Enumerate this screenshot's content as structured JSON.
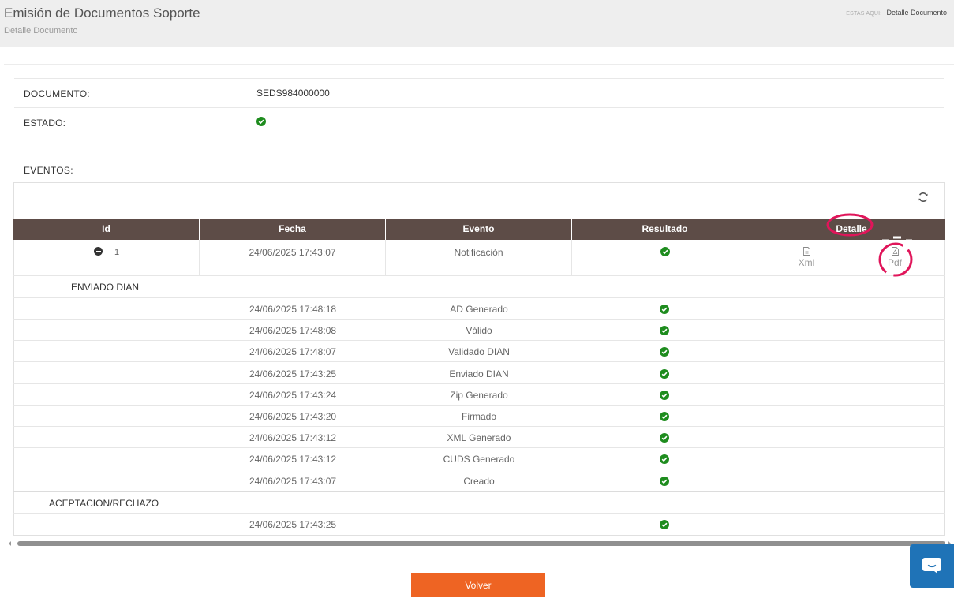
{
  "header": {
    "title": "Emisión de Documentos Soporte",
    "subtitle": "Detalle Documento",
    "breadcrumb_label": "ESTAS AQUI:",
    "breadcrumb_current": "Detalle Documento"
  },
  "document": {
    "label": "DOCUMENTO:",
    "value": "SEDS984000000",
    "estado_label": "ESTADO:",
    "estado_icon": "check-circle-icon"
  },
  "eventos": {
    "label": "EVENTOS:",
    "columns": [
      "Id",
      "Fecha",
      "Evento",
      "Resultado",
      "Detalle"
    ],
    "main_row": {
      "id": "1",
      "fecha": "24/06/2025 17:43:07",
      "evento": "Notificación",
      "resultado_icon": "check-circle-icon",
      "xml_label": "Xml",
      "pdf_label": "Pdf"
    },
    "groups": [
      {
        "name": "ENVIADO DIAN",
        "rows": [
          {
            "fecha": "24/06/2025 17:48:18",
            "evento": "AD Generado"
          },
          {
            "fecha": "24/06/2025 17:48:08",
            "evento": "Válido"
          },
          {
            "fecha": "24/06/2025 17:48:07",
            "evento": "Validado DIAN"
          },
          {
            "fecha": "24/06/2025 17:43:25",
            "evento": "Enviado DIAN"
          },
          {
            "fecha": "24/06/2025 17:43:24",
            "evento": "Zip Generado"
          },
          {
            "fecha": "24/06/2025 17:43:20",
            "evento": "Firmado"
          },
          {
            "fecha": "24/06/2025 17:43:12",
            "evento": "XML Generado"
          },
          {
            "fecha": "24/06/2025 17:43:12",
            "evento": "CUDS Generado"
          },
          {
            "fecha": "24/06/2025 17:43:07",
            "evento": "Creado"
          }
        ]
      },
      {
        "name": "ACEPTACION/RECHAZO",
        "rows": [
          {
            "fecha": "24/06/2025 17:43:25",
            "evento": ""
          }
        ]
      }
    ]
  },
  "actions": {
    "volver_label": "Volver"
  },
  "colors": {
    "header_bg": "#eeeeee",
    "table_header_bg": "#5d4c47",
    "success": "#1e8c1e",
    "button": "#ee6423",
    "chat": "#1f73b7",
    "annotation": "#e0155a"
  }
}
